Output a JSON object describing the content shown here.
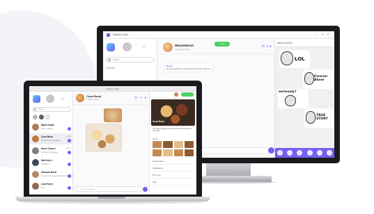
{
  "monitor": {
    "window_title": "Rakuten Viber",
    "list": {
      "search_placeholder": "Search",
      "section_label": "Favorites",
      "more_label": "•••"
    },
    "chat": {
      "name": "WhatsNeech",
      "subtitle": "4,562 members",
      "message_sender": "Neelia",
      "message_text": "Did you watch the latest episode? Don't spoil it!",
      "input_placeholder": "Type a message...",
      "icons": [
        "phone-icon",
        "share-icon",
        "info-icon"
      ]
    },
    "stickers": {
      "header": "Memes (15/20)",
      "top_button": "Join",
      "items": [
        "LOL",
        "Forever Alone",
        "seriously?",
        "TRUE STORY"
      ]
    }
  },
  "laptop": {
    "window_title": "Rakuten Viber",
    "list": {
      "search_placeholder": "Search",
      "more_label": "•••",
      "chats": [
        {
          "name": "Maria Gupta",
          "message": "Sent a picture",
          "time": "",
          "color": "#a67c5b"
        },
        {
          "name": "Cook Book",
          "message": "My 35 Photo Message",
          "time": "10:30",
          "color": "#c17a3a"
        },
        {
          "name": "Norm Chance",
          "message": "35 Photo Message",
          "time": "09:12",
          "color": "#7a7f86"
        },
        {
          "name": "McKinley 1",
          "message": "5 Stickers",
          "time": "",
          "color": "#3e4a5a"
        },
        {
          "name": "Eduardo Beele",
          "message": "Do you have some plans for the weekend?",
          "time": "",
          "color": "#b58968"
        },
        {
          "name": "Lisa Foster",
          "message": "Ok",
          "time": "",
          "color": "#8d6b58"
        }
      ]
    },
    "chat": {
      "name": "Cook Book",
      "subtitle": "1,325 members",
      "input_placeholder": "Type a message...",
      "icons": [
        "phone-icon",
        "share-icon",
        "info-icon"
      ]
    },
    "info": {
      "cover_title": "Cook Book",
      "description": "Find great recipes to cook for the food lovers in your life!",
      "media_label": "Media",
      "media_link": "See All",
      "options": [
        "Group Name",
        "Notifications",
        "Pin to top",
        "Hide"
      ]
    }
  },
  "colors": {
    "accent": "#7360f2",
    "green": "#4cd262",
    "bezel": "#1a1a1c"
  }
}
